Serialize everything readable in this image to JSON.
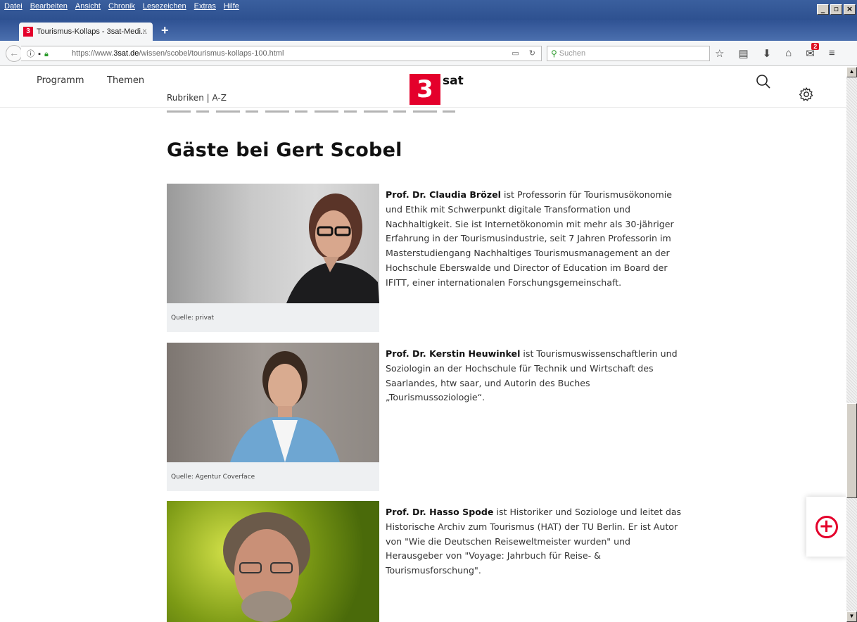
{
  "menubar": {
    "items": [
      "Datei",
      "Bearbeiten",
      "Ansicht",
      "Chronik",
      "Lesezeichen",
      "Extras",
      "Hilfe"
    ]
  },
  "tab": {
    "favicon_text": "3",
    "title": "Tourismus-Kollaps - 3sat-Medi...",
    "close": "×"
  },
  "newtab": "+",
  "address": {
    "url_prefix": "https://www.",
    "url_domain": "3sat.de",
    "url_path": "/wissen/scobel/tourismus-kollaps-100.html",
    "search_placeholder": "Suchen"
  },
  "toolbar": {
    "notification_count": "2"
  },
  "site": {
    "nav": {
      "programm": "Programm",
      "themen": "Themen",
      "rubriken": "Rubriken | A-Z"
    },
    "logo": {
      "mark": "3",
      "text": "sat"
    }
  },
  "main": {
    "heading": "Gäste bei Gert Scobel",
    "guests": [
      {
        "name": "Prof. Dr. Claudia Brözel",
        "bio": " ist Professorin für Tourismusökonomie und Ethik mit Schwerpunkt digitale Transformation und Nachhaltigkeit. Sie ist Internetökonomin mit mehr als 30-jähriger Erfahrung in der Tourismusindustrie, seit 7 Jahren Professorin im Masterstudiengang Nachhaltiges Tourismusmanagement an der Hochschule Eberswalde und Director of Education im Board der IFITT, einer internationalen Forschungsgemeinschaft.",
        "caption": "Quelle: privat"
      },
      {
        "name": "Prof. Dr. Kerstin Heuwinkel",
        "bio": " ist Tourismuswissenschaftlerin und Soziologin an der Hochschule für Technik und Wirtschaft des Saarlandes, htw saar, und Autorin des Buches „Tourismussoziologie“.",
        "caption": "Quelle: Agentur Coverface"
      },
      {
        "name": "Prof. Dr. Hasso Spode",
        "bio": " ist Historiker und Soziologe und leitet das Historische Archiv zum Tourismus (HAT) der TU Berlin. Er ist Autor von \"Wie die Deutschen Reiseweltmeister wurden\" und Herausgeber von \"Voyage: Jahrbuch für Reise- & Tourismusforschung\"."
      }
    ]
  },
  "fab": {
    "symbol": "+"
  },
  "colors": {
    "brand": "#e4002b",
    "chrome": "#2f5293"
  }
}
